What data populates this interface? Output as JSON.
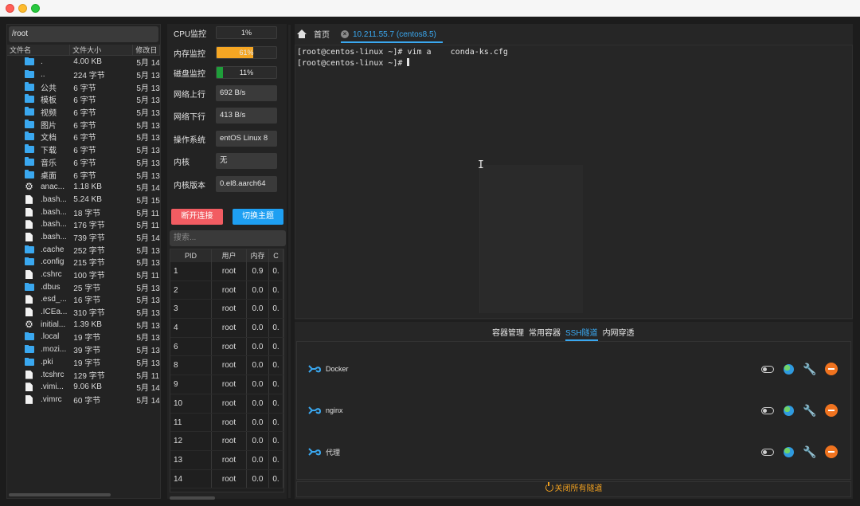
{
  "file_panel": {
    "path": "/root",
    "columns": [
      "文件名",
      "文件大小",
      "修改日"
    ],
    "files": [
      {
        "icon": "folder-icon",
        "name": ".",
        "size": "4.00 KB",
        "date": "5月 14"
      },
      {
        "icon": "folder-icon",
        "name": "..",
        "size": "224 字节",
        "date": "5月 13"
      },
      {
        "icon": "folder-icon",
        "name": "公共",
        "size": "6 字节",
        "date": "5月 13"
      },
      {
        "icon": "folder-icon",
        "name": "模板",
        "size": "6 字节",
        "date": "5月 13"
      },
      {
        "icon": "folder-icon",
        "name": "视频",
        "size": "6 字节",
        "date": "5月 13"
      },
      {
        "icon": "folder-icon",
        "name": "图片",
        "size": "6 字节",
        "date": "5月 13"
      },
      {
        "icon": "folder-icon",
        "name": "文档",
        "size": "6 字节",
        "date": "5月 13"
      },
      {
        "icon": "folder-icon",
        "name": "下载",
        "size": "6 字节",
        "date": "5月 13"
      },
      {
        "icon": "folder-icon",
        "name": "音乐",
        "size": "6 字节",
        "date": "5月 13"
      },
      {
        "icon": "folder-icon",
        "name": "桌面",
        "size": "6 字节",
        "date": "5月 13"
      },
      {
        "icon": "gear-icon",
        "name": "anac...",
        "size": "1.18 KB",
        "date": "5月 14"
      },
      {
        "icon": "file-icon",
        "name": ".bash...",
        "size": "5.24 KB",
        "date": "5月 15"
      },
      {
        "icon": "file-icon",
        "name": ".bash...",
        "size": "18 字节",
        "date": "5月 11"
      },
      {
        "icon": "file-icon",
        "name": ".bash...",
        "size": "176 字节",
        "date": "5月 11"
      },
      {
        "icon": "file-icon",
        "name": ".bash...",
        "size": "739 字节",
        "date": "5月 14"
      },
      {
        "icon": "folder-icon",
        "name": ".cache",
        "size": "252 字节",
        "date": "5月 13"
      },
      {
        "icon": "folder-icon",
        "name": ".config",
        "size": "215 字节",
        "date": "5月 13"
      },
      {
        "icon": "file-icon",
        "name": ".cshrc",
        "size": "100 字节",
        "date": "5月 11"
      },
      {
        "icon": "folder-icon",
        "name": ".dbus",
        "size": "25 字节",
        "date": "5月 13"
      },
      {
        "icon": "file-icon",
        "name": ".esd_...",
        "size": "16 字节",
        "date": "5月 13"
      },
      {
        "icon": "file-icon",
        "name": ".ICEa...",
        "size": "310 字节",
        "date": "5月 13"
      },
      {
        "icon": "gear-icon",
        "name": "initial...",
        "size": "1.39 KB",
        "date": "5月 13"
      },
      {
        "icon": "folder-icon",
        "name": ".local",
        "size": "19 字节",
        "date": "5月 13"
      },
      {
        "icon": "folder-icon",
        "name": ".mozi...",
        "size": "39 字节",
        "date": "5月 13"
      },
      {
        "icon": "folder-icon",
        "name": ".pki",
        "size": "19 字节",
        "date": "5月 13"
      },
      {
        "icon": "file-icon",
        "name": ".tcshrc",
        "size": "129 字节",
        "date": "5月 11"
      },
      {
        "icon": "file-icon",
        "name": ".vimi...",
        "size": "9.06 KB",
        "date": "5月 14"
      },
      {
        "icon": "file-icon",
        "name": ".vimrc",
        "size": "60 字节",
        "date": "5月 14"
      }
    ]
  },
  "monitor": {
    "cpu": {
      "label": "CPU监控",
      "percent": 1,
      "text": "1%",
      "color": "#2b2b2b"
    },
    "memory": {
      "label": "内存监控",
      "percent": 61,
      "text": "61%",
      "color": "#f5a623"
    },
    "disk": {
      "label": "磁盘监控",
      "percent": 11,
      "text": "11%",
      "color": "#1f9e3a"
    },
    "upload": {
      "label": "网络上行",
      "value": "692 B/s"
    },
    "download": {
      "label": "网络下行",
      "value": "413 B/s"
    },
    "os": {
      "label": "操作系统",
      "value": "entOS Linux 8"
    },
    "kernel": {
      "label": "内核",
      "value": "无"
    },
    "kernel_version": {
      "label": "内核版本",
      "value": "0.el8.aarch64"
    },
    "disconnect_label": "断开连接",
    "theme_label": "切换主题",
    "search_placeholder": "搜索...",
    "process_columns": [
      "PID",
      "用户",
      "内存",
      "C"
    ],
    "processes": [
      {
        "pid": "1",
        "user": "root",
        "mem": "0.9",
        "cpu": "0."
      },
      {
        "pid": "2",
        "user": "root",
        "mem": "0.0",
        "cpu": "0."
      },
      {
        "pid": "3",
        "user": "root",
        "mem": "0.0",
        "cpu": "0."
      },
      {
        "pid": "4",
        "user": "root",
        "mem": "0.0",
        "cpu": "0."
      },
      {
        "pid": "6",
        "user": "root",
        "mem": "0.0",
        "cpu": "0."
      },
      {
        "pid": "8",
        "user": "root",
        "mem": "0.0",
        "cpu": "0."
      },
      {
        "pid": "9",
        "user": "root",
        "mem": "0.0",
        "cpu": "0."
      },
      {
        "pid": "10",
        "user": "root",
        "mem": "0.0",
        "cpu": "0."
      },
      {
        "pid": "11",
        "user": "root",
        "mem": "0.0",
        "cpu": "0."
      },
      {
        "pid": "12",
        "user": "root",
        "mem": "0.0",
        "cpu": "0."
      },
      {
        "pid": "13",
        "user": "root",
        "mem": "0.0",
        "cpu": "0."
      },
      {
        "pid": "14",
        "user": "root",
        "mem": "0.0",
        "cpu": "0."
      }
    ]
  },
  "tabs": {
    "home_label": "首页",
    "session_label": "10.211.55.7 (centos8.5)"
  },
  "terminal": {
    "lines": [
      "[root@centos-linux ~]# vim a    conda-ks.cfg",
      "[root@centos-linux ~]# "
    ]
  },
  "sub_tabs": [
    "容器管理",
    "常用容器",
    "SSH隧道",
    "内网穿透"
  ],
  "active_sub_tab": "SSH隧道",
  "tunnels": [
    {
      "name": "Docker",
      "enabled": false
    },
    {
      "name": "nginx",
      "enabled": false
    },
    {
      "name": "代理",
      "enabled": false
    }
  ],
  "close_all_label": "关闭所有隧道",
  "colors": {
    "accent": "#3aa8f0",
    "danger": "#f25c62",
    "warning": "#f0a020",
    "orange": "#f0731f"
  }
}
